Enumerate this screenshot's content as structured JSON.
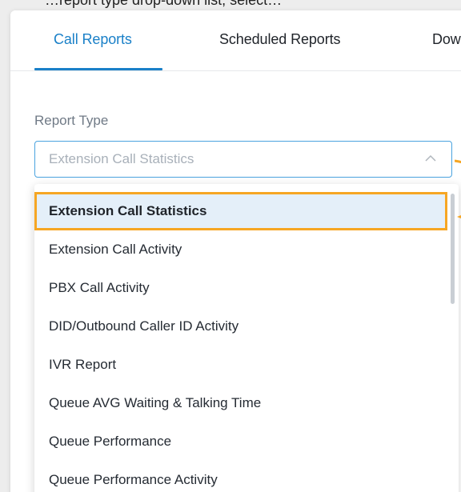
{
  "header_fragment": "…report type drop-down list, select…",
  "tabs": [
    {
      "label": "Call Reports",
      "active": true
    },
    {
      "label": "Scheduled Reports",
      "active": false
    },
    {
      "label": "Dow",
      "active": false
    }
  ],
  "report_type": {
    "label": "Report Type",
    "value": "Extension Call Statistics"
  },
  "dropdown": {
    "options": [
      "Extension Call Statistics",
      "Extension Call Activity",
      "PBX Call Activity",
      "DID/Outbound Caller ID Activity",
      "IVR Report",
      "Queue AVG Waiting & Talking Time",
      "Queue Performance",
      "Queue Performance Activity"
    ],
    "selected": "Extension Call Statistics"
  },
  "colors": {
    "accent": "#1a80c8",
    "highlight": "#f6a623",
    "selected_bg": "#e4eff9"
  }
}
